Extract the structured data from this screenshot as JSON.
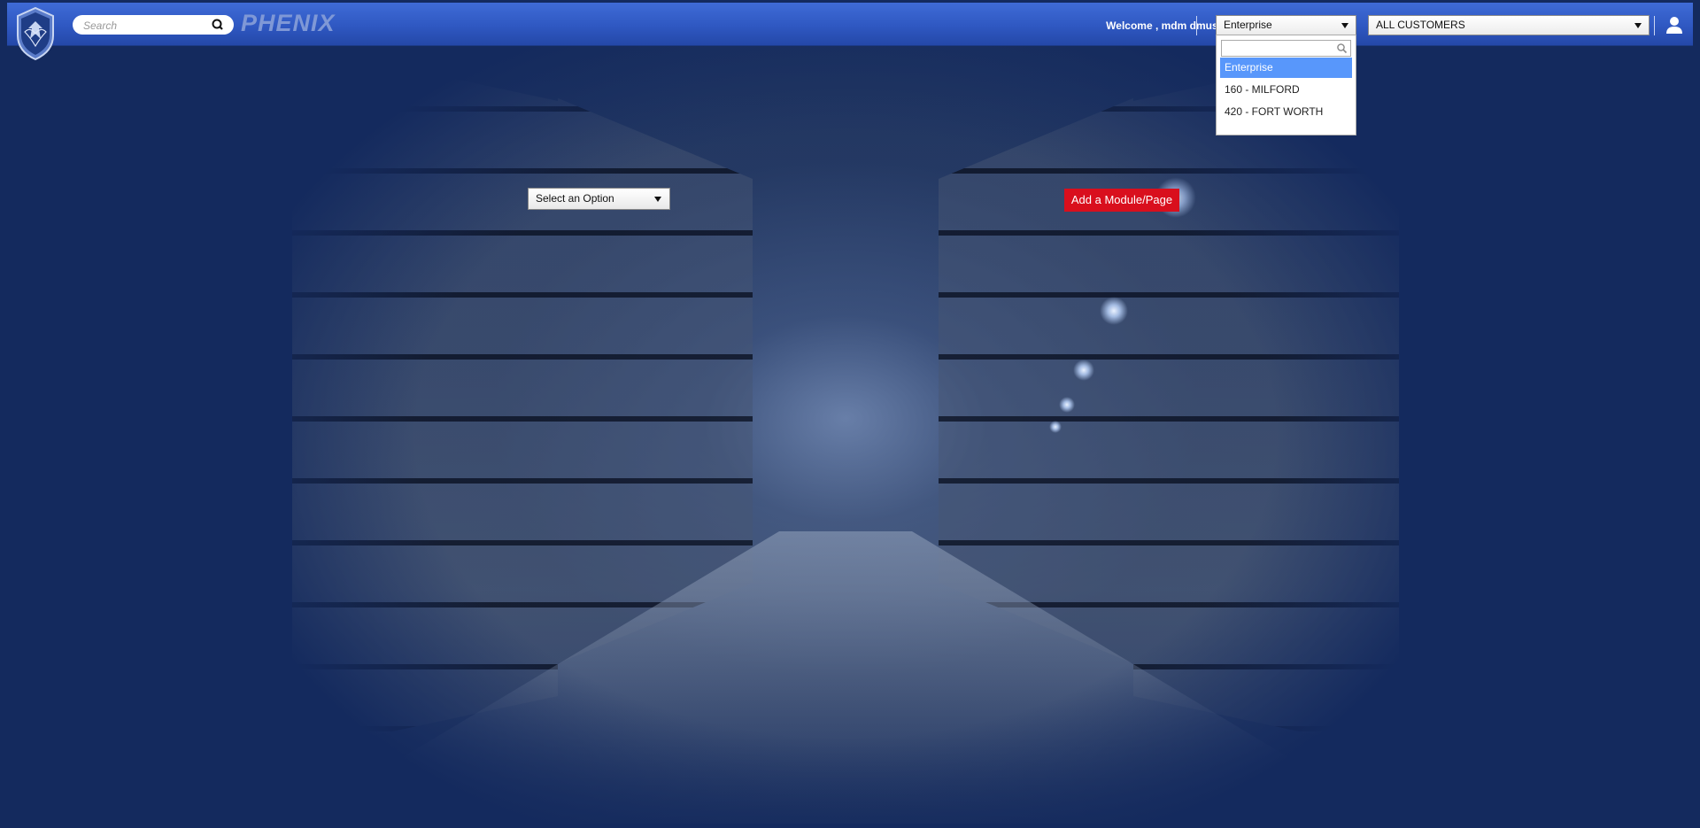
{
  "header": {
    "search_placeholder": "Search",
    "brand": "PHENIX",
    "welcome": "Welcome , mdm dmuser",
    "location_select": "Enterprise",
    "customer_select": "ALL CUSTOMERS"
  },
  "location_dropdown": {
    "search_value": "",
    "options": [
      "Enterprise",
      "160 - MILFORD",
      "420 - FORT WORTH"
    ],
    "selected": "Enterprise"
  },
  "content": {
    "option_select": "Select an Option",
    "add_button": "Add a Module/Page"
  },
  "colors": {
    "topbar": "#3f6bd6",
    "page_bg": "#142a5e",
    "add_button": "#d90f1d",
    "dropdown_highlight": "#5897fb"
  },
  "icons": [
    "logo-emblem-icon",
    "search-icon",
    "user-icon",
    "chevron-down-icon"
  ]
}
